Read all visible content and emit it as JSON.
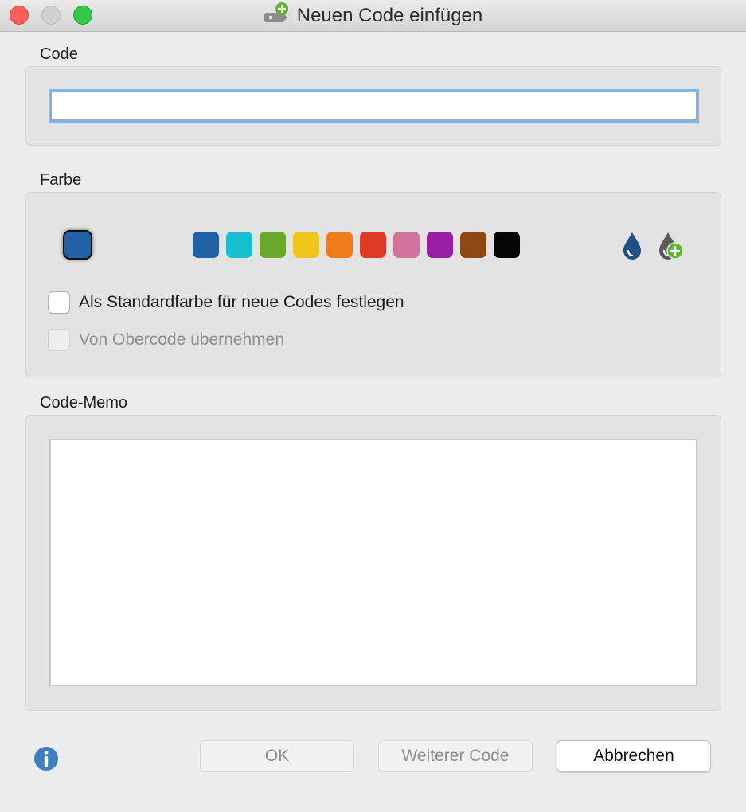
{
  "window": {
    "title": "Neuen Code einfügen",
    "title_icon": "code-add-icon"
  },
  "code_section": {
    "label": "Code",
    "input_value": "",
    "input_placeholder": ""
  },
  "color_section": {
    "label": "Farbe",
    "selected_color": "#2162a6",
    "palette": [
      {
        "name": "blue",
        "hex": "#2162a6"
      },
      {
        "name": "cyan",
        "hex": "#16c0d0"
      },
      {
        "name": "green",
        "hex": "#6aa82a"
      },
      {
        "name": "yellow",
        "hex": "#f0c61a"
      },
      {
        "name": "orange",
        "hex": "#ef7b1a"
      },
      {
        "name": "red",
        "hex": "#df3a25"
      },
      {
        "name": "pink",
        "hex": "#d2739e"
      },
      {
        "name": "purple",
        "hex": "#9a1ea3"
      },
      {
        "name": "brown",
        "hex": "#8f4713"
      },
      {
        "name": "black",
        "hex": "#050505"
      }
    ],
    "color_picker_icon": "drop-icon",
    "add_color_icon": "drop-add-icon",
    "checkbox_default": {
      "label": "Als Standardfarbe für neue Codes festlegen",
      "checked": false,
      "enabled": true
    },
    "checkbox_parent": {
      "label": "Von Obercode übernehmen",
      "checked": false,
      "enabled": false
    }
  },
  "memo_section": {
    "label": "Code-Memo",
    "value": ""
  },
  "footer": {
    "info_icon": "info-icon",
    "ok_label": "OK",
    "more_label": "Weiterer Code",
    "cancel_label": "Abbrechen"
  }
}
